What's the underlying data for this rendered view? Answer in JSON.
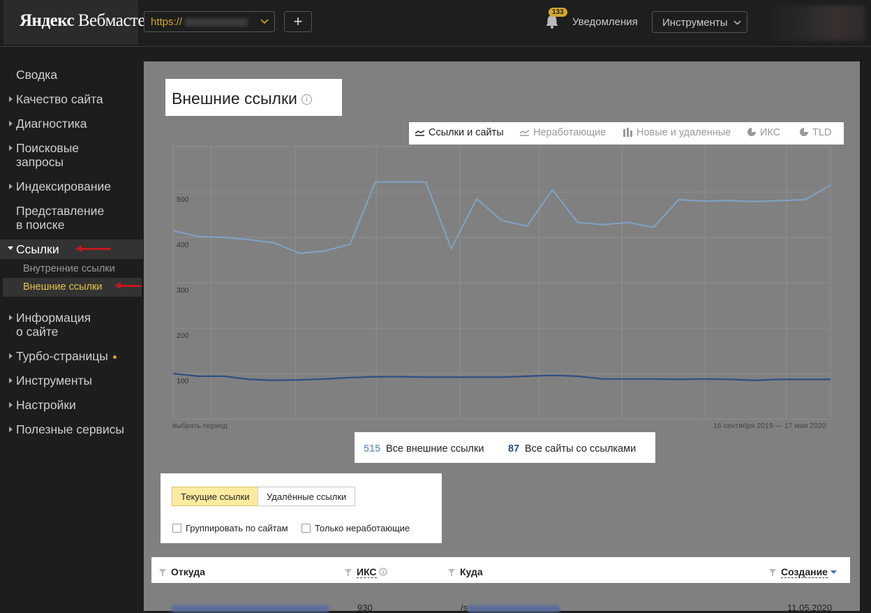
{
  "header": {
    "logo_bold": "Яндекс",
    "logo_rest": "Вебмастер",
    "site_url": "https://",
    "add_label": "+",
    "notifications_count": "133",
    "notifications_label": "Уведомления",
    "tools_label": "Инструменты"
  },
  "sidebar": {
    "items": [
      {
        "label": "Сводка"
      },
      {
        "label": "Качество сайта"
      },
      {
        "label": "Диагностика"
      },
      {
        "label": "Поисковые"
      },
      {
        "label": "запросы"
      },
      {
        "label": "Индексирование"
      },
      {
        "label": "Представление"
      },
      {
        "label": "в поиске"
      },
      {
        "label": "Ссылки"
      },
      {
        "label": "Информация"
      },
      {
        "label": "о сайте"
      },
      {
        "label": "Турбо-страницы"
      },
      {
        "label": "Инструменты"
      },
      {
        "label": "Настройки"
      },
      {
        "label": "Полезные сервисы"
      }
    ],
    "sub_items": [
      {
        "label": "Внутренние ссылки"
      },
      {
        "label": "Внешние ссылки"
      }
    ]
  },
  "page": {
    "title": "Внешние ссылки",
    "info_glyph": "i"
  },
  "chart_tabs": [
    {
      "label": "Ссылки и сайты"
    },
    {
      "label": "Неработающие"
    },
    {
      "label": "Новые и удаленные"
    },
    {
      "label": "ИКС"
    },
    {
      "label": "TLD"
    }
  ],
  "chart_data": {
    "type": "line",
    "ylim": [
      0,
      600
    ],
    "yticks": [
      "0",
      "100",
      "200",
      "300",
      "400",
      "500"
    ],
    "series": [
      {
        "name": "Все внешние ссылки",
        "color": "#7fa3c8",
        "values": [
          415,
          402,
          400,
          395,
          388,
          365,
          370,
          385,
          522,
          522,
          522,
          375,
          485,
          437,
          425,
          505,
          433,
          428,
          433,
          422,
          483,
          480,
          481,
          479,
          481,
          483,
          515
        ]
      },
      {
        "name": "Все сайты со ссылками",
        "color": "#2e4f84",
        "values": [
          100,
          94,
          94,
          87,
          85,
          86,
          88,
          91,
          93,
          93,
          92,
          92,
          92,
          92,
          94,
          96,
          94,
          88,
          88,
          88,
          87,
          88,
          87,
          85,
          87,
          87,
          87
        ]
      }
    ],
    "period_label": "выбрать период",
    "date_range": "16 сентября 2019 — 17 мая 2020"
  },
  "totals": {
    "links_value": "515",
    "links_label": "Все внешние ссылки",
    "sites_value": "87",
    "sites_label": "Все сайты со ссылками"
  },
  "filters": {
    "current_label": "Текущие ссылки",
    "deleted_label": "Удалённые ссылки",
    "group_label": "Группировать по сайтам",
    "broken_only_label": "Только неработающие"
  },
  "table": {
    "columns": [
      "Откуда",
      "ИКС",
      "Куда",
      "Создание"
    ],
    "rows": [
      {
        "iks": "930",
        "to_prefix": "/s",
        "date": "11.05.2020"
      }
    ]
  },
  "colors": {
    "accent": "#d5a72b",
    "arrow": "#c0191e",
    "series_links": "#7fa3c8",
    "series_sites": "#2e4f84"
  }
}
